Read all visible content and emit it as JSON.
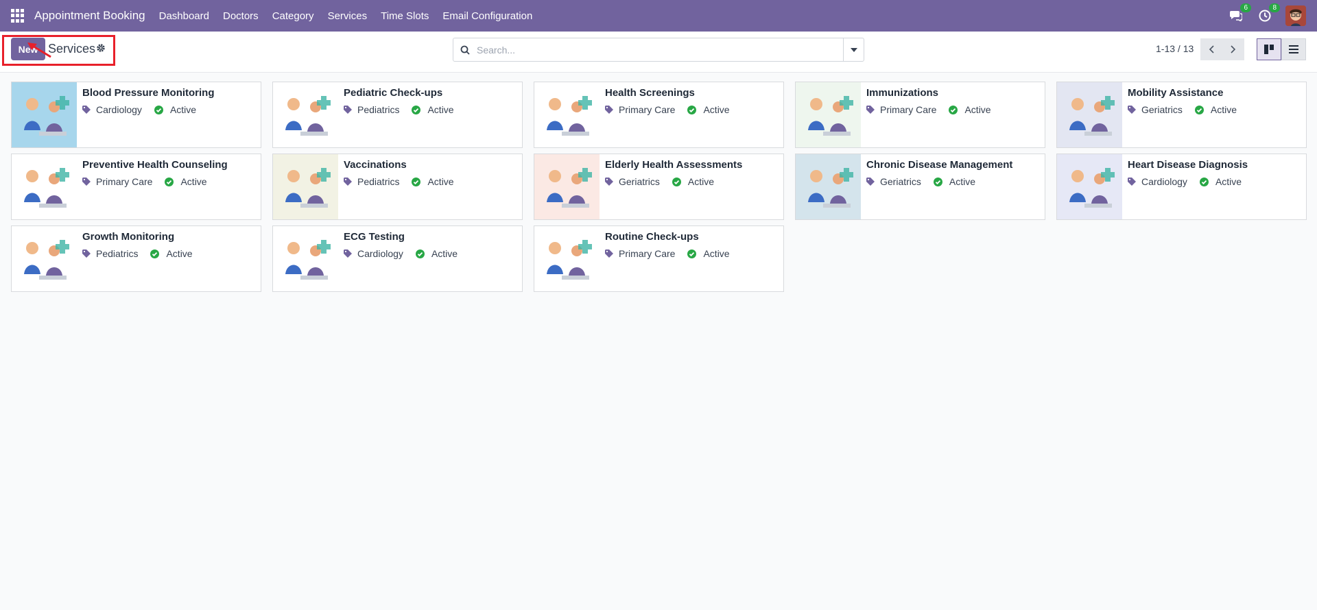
{
  "app": {
    "brand": "Appointment Booking",
    "menu": [
      "Dashboard",
      "Doctors",
      "Category",
      "Services",
      "Time Slots",
      "Email Configuration"
    ],
    "messages_count": "6",
    "activities_count": "8"
  },
  "control": {
    "new_label": "New",
    "title": "Services",
    "search_placeholder": "Search...",
    "pager": "1-13 / 13"
  },
  "colors": {
    "brand": "#71639e",
    "badge": "#28a745",
    "tag": "#71639e",
    "active": "#28a745",
    "highlight": "#e8202a"
  },
  "services": [
    {
      "name": "Blood Pressure Monitoring",
      "category": "Cardiology",
      "status": "Active",
      "thumb_bg": "#a7d6ec"
    },
    {
      "name": "Pediatric Check-ups",
      "category": "Pediatrics",
      "status": "Active",
      "thumb_bg": "#ffffff"
    },
    {
      "name": "Health Screenings",
      "category": "Primary Care",
      "status": "Active",
      "thumb_bg": "#ffffff"
    },
    {
      "name": "Immunizations",
      "category": "Primary Care",
      "status": "Active",
      "thumb_bg": "#eef6ee"
    },
    {
      "name": "Mobility Assistance",
      "category": "Geriatrics",
      "status": "Active",
      "thumb_bg": "#e3e6f2"
    },
    {
      "name": "Preventive Health Counseling",
      "category": "Primary Care",
      "status": "Active",
      "thumb_bg": "#ffffff"
    },
    {
      "name": "Vaccinations",
      "category": "Pediatrics",
      "status": "Active",
      "thumb_bg": "#f2f2e4"
    },
    {
      "name": "Elderly Health Assessments",
      "category": "Geriatrics",
      "status": "Active",
      "thumb_bg": "#fbe9e4"
    },
    {
      "name": "Chronic Disease Management",
      "category": "Geriatrics",
      "status": "Active",
      "thumb_bg": "#d4e4ec"
    },
    {
      "name": "Heart Disease Diagnosis",
      "category": "Cardiology",
      "status": "Active",
      "thumb_bg": "#e6e8f6"
    },
    {
      "name": "Growth Monitoring",
      "category": "Pediatrics",
      "status": "Active",
      "thumb_bg": "#ffffff"
    },
    {
      "name": "ECG Testing",
      "category": "Cardiology",
      "status": "Active",
      "thumb_bg": "#ffffff"
    },
    {
      "name": "Routine Check-ups",
      "category": "Primary Care",
      "status": "Active",
      "thumb_bg": "#ffffff"
    }
  ]
}
